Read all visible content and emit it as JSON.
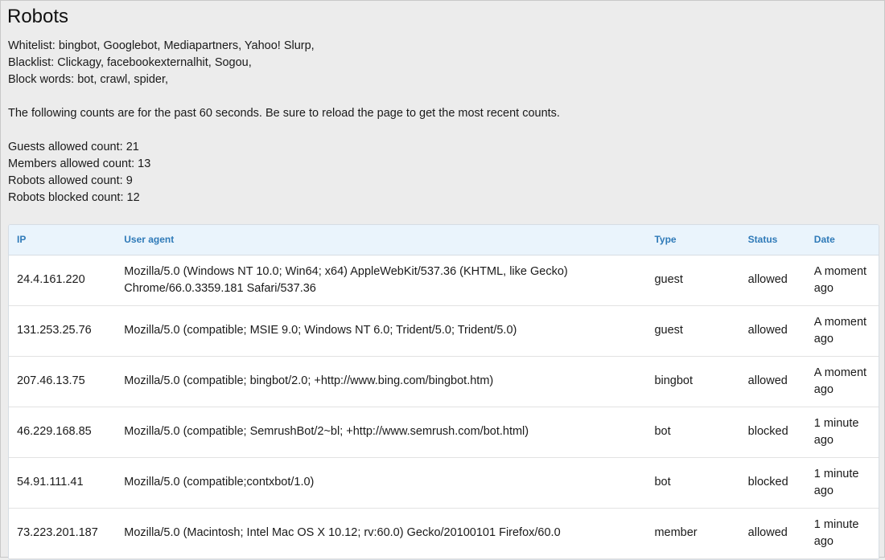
{
  "page": {
    "title": "Robots",
    "whitelist": "Whitelist: bingbot, Googlebot, Mediapartners, Yahoo! Slurp,",
    "blacklist": "Blacklist: Clickagy, facebookexternalhit, Sogou,",
    "block_words": "Block words: bot, crawl, spider,",
    "counts_note": "The following counts are for the past 60 seconds. Be sure to reload the page to get the most recent counts.",
    "guests_allowed": "Guests allowed count: 21",
    "members_allowed": "Members allowed count: 13",
    "robots_allowed": "Robots allowed count: 9",
    "robots_blocked": "Robots blocked count: 12"
  },
  "table": {
    "headers": {
      "ip": "IP",
      "user_agent": "User agent",
      "type": "Type",
      "status": "Status",
      "date": "Date"
    },
    "rows": [
      {
        "ip": "24.4.161.220",
        "user_agent": "Mozilla/5.0 (Windows NT 10.0; Win64; x64) AppleWebKit/537.36 (KHTML, like Gecko) Chrome/66.0.3359.181 Safari/537.36",
        "type": "guest",
        "status": "allowed",
        "date": "A moment ago"
      },
      {
        "ip": "131.253.25.76",
        "user_agent": "Mozilla/5.0 (compatible; MSIE 9.0; Windows NT 6.0; Trident/5.0; Trident/5.0)",
        "type": "guest",
        "status": "allowed",
        "date": "A moment ago"
      },
      {
        "ip": "207.46.13.75",
        "user_agent": "Mozilla/5.0 (compatible; bingbot/2.0; +http://www.bing.com/bingbot.htm)",
        "type": "bingbot",
        "status": "allowed",
        "date": "A moment ago"
      },
      {
        "ip": "46.229.168.85",
        "user_agent": "Mozilla/5.0 (compatible; SemrushBot/2~bl; +http://www.semrush.com/bot.html)",
        "type": "bot",
        "status": "blocked",
        "date": "1 minute ago"
      },
      {
        "ip": "54.91.111.41",
        "user_agent": "Mozilla/5.0 (compatible;contxbot/1.0)",
        "type": "bot",
        "status": "blocked",
        "date": "1 minute ago"
      },
      {
        "ip": "73.223.201.187",
        "user_agent": "Mozilla/5.0 (Macintosh; Intel Mac OS X 10.12; rv:60.0) Gecko/20100101 Firefox/60.0",
        "type": "member",
        "status": "allowed",
        "date": "1 minute ago"
      }
    ]
  },
  "colors": {
    "header_text": "#2f7ab8",
    "header_bg": "#eaf4fc",
    "page_bg": "#ececec"
  }
}
